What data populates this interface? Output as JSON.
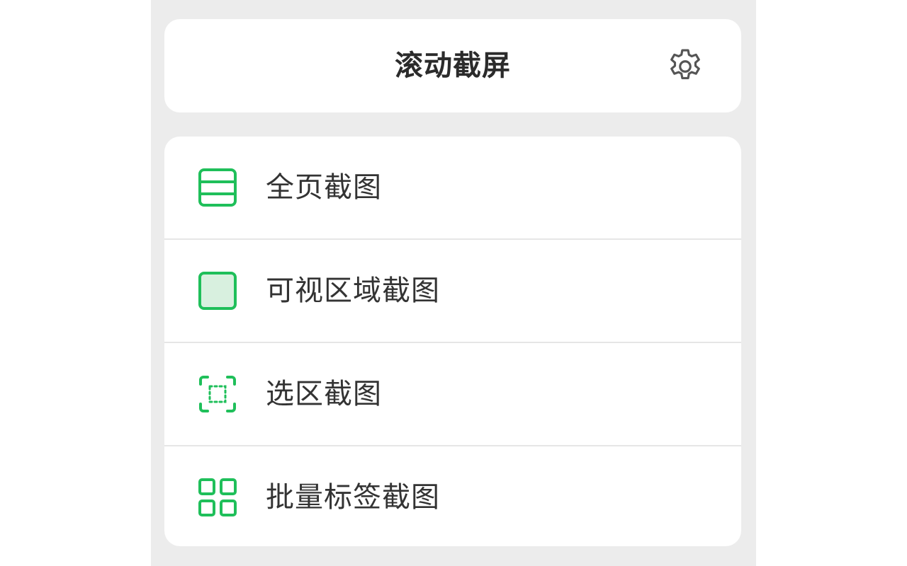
{
  "header": {
    "title": "滚动截屏",
    "settings_icon": "gear-icon"
  },
  "menu": {
    "items": [
      {
        "label": "全页截图",
        "icon": "full-page-icon"
      },
      {
        "label": "可视区域截图",
        "icon": "visible-area-icon"
      },
      {
        "label": "选区截图",
        "icon": "selection-icon"
      },
      {
        "label": "批量标签截图",
        "icon": "batch-tabs-icon"
      }
    ]
  },
  "colors": {
    "accent": "#1fbf5a",
    "accent_fill": "#d8f0df",
    "background": "#ececec",
    "card": "#ffffff",
    "text": "#333333",
    "icon_gray": "#555555"
  }
}
